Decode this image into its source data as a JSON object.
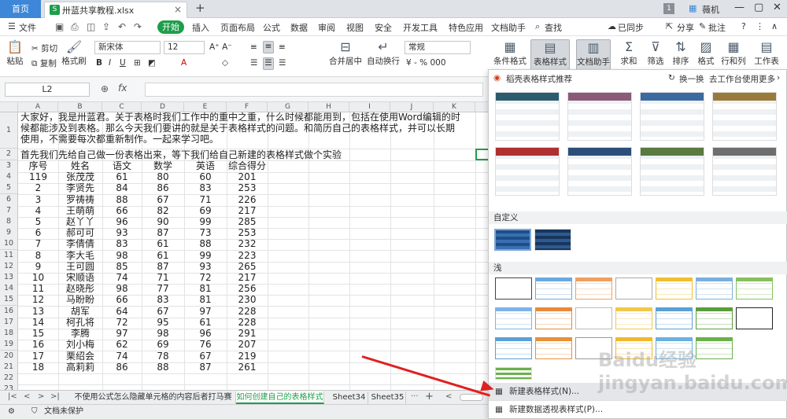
{
  "titlebar": {
    "home_tab": "首页",
    "file_tab": "卅蓝共享教程.xlsx",
    "sync": "已同步",
    "share": "分享",
    "annotate": "批注",
    "page_num": "1",
    "user": "薇机"
  },
  "menu": {
    "file": "文件",
    "start": "开始",
    "items": [
      "插入",
      "页面布局",
      "公式",
      "数据",
      "审阅",
      "视图",
      "安全",
      "开发工具",
      "特色应用",
      "文档助手"
    ],
    "search": "查找"
  },
  "ribbon": {
    "paste": "粘贴",
    "cut": "剪切",
    "copy": "复制",
    "format_painter": "格式刷",
    "font": "新宋体",
    "size": "12",
    "merge": "合并居中",
    "wrap": "自动换行",
    "numfmt": "常规",
    "cond": "条件格式",
    "table_style": "表格样式",
    "doc_helper": "文档助手",
    "sum": "求和",
    "filter": "筛选",
    "sort": "排序",
    "format": "格式",
    "rowcol": "行和列",
    "worksheet": "工作表"
  },
  "formula": {
    "cell_ref": "L2",
    "fx": "fx"
  },
  "sheet": {
    "columns": [
      "A",
      "B",
      "C",
      "D",
      "E",
      "F",
      "G",
      "H",
      "I",
      "J",
      "K"
    ],
    "rows": [
      "1",
      "2",
      "3",
      "4",
      "5",
      "6",
      "7",
      "8",
      "9",
      "10",
      "11",
      "12",
      "13",
      "14",
      "15",
      "16",
      "17",
      "18",
      "19",
      "20",
      "21",
      "22",
      "23"
    ],
    "intro": "大家好，我是卅蓝君。关于表格时我们工作中的重中之重，什么时候都能用到，包括在使用Word编辑的时候都能涉及到表格。那么今天我们要讲的就是关于表格样式的问题。和简历自己的表格样式，并可以长期使用，不需要每次都重新制作。一起来学习吧。",
    "row2": "首先我们先给自己做一份表格出来，等下我们给自己新建的表格样式做个实验",
    "header": [
      "序号",
      "姓名",
      "语文",
      "数学",
      "英语",
      "综合得分"
    ],
    "data": [
      [
        "119",
        "张茂茂",
        "61",
        "80",
        "60",
        "201"
      ],
      [
        "2",
        "李贤先",
        "84",
        "86",
        "83",
        "253"
      ],
      [
        "3",
        "罗祷祷",
        "88",
        "67",
        "71",
        "226"
      ],
      [
        "4",
        "王萌萌",
        "66",
        "82",
        "69",
        "217"
      ],
      [
        "5",
        "赵丫丫",
        "96",
        "90",
        "99",
        "285"
      ],
      [
        "6",
        "郝可可",
        "93",
        "87",
        "73",
        "253"
      ],
      [
        "7",
        "李倩倩",
        "83",
        "61",
        "88",
        "232"
      ],
      [
        "8",
        "李大毛",
        "98",
        "61",
        "99",
        "223"
      ],
      [
        "9",
        "王可圆",
        "85",
        "87",
        "93",
        "265"
      ],
      [
        "10",
        "宋顺语",
        "74",
        "71",
        "72",
        "217"
      ],
      [
        "11",
        "赵晓彤",
        "98",
        "77",
        "81",
        "256"
      ],
      [
        "12",
        "马盼盼",
        "66",
        "83",
        "81",
        "230"
      ],
      [
        "13",
        "胡军",
        "64",
        "67",
        "97",
        "228"
      ],
      [
        "14",
        "柯孔将",
        "72",
        "95",
        "61",
        "228"
      ],
      [
        "15",
        "李腾",
        "97",
        "98",
        "96",
        "291"
      ],
      [
        "16",
        "刘小梅",
        "62",
        "69",
        "76",
        "207"
      ],
      [
        "17",
        "栗绍会",
        "74",
        "78",
        "67",
        "219"
      ],
      [
        "18",
        "高莉莉",
        "86",
        "88",
        "87",
        "261"
      ]
    ]
  },
  "tabs": [
    "不使用公式怎么隐藏单元格的内容后者打马赛克",
    "如何创建自己的表格样式",
    "Sheet34",
    "Sheet35"
  ],
  "status": {
    "protect": "文档未保护"
  },
  "panel": {
    "title": "稻壳表格样式推荐",
    "refresh": "换一换",
    "more": "去工作台使用更多",
    "custom": "自定义",
    "light": "浅",
    "new_style": "新建表格样式(N)...",
    "new_pivot": "新建数据透视表样式(P)..."
  },
  "colors": {
    "green": "#1e9e4a",
    "blue": "#3d86d8",
    "red": "#e02020"
  },
  "watermark": "Baidu经验 jingyan.baidu.com"
}
